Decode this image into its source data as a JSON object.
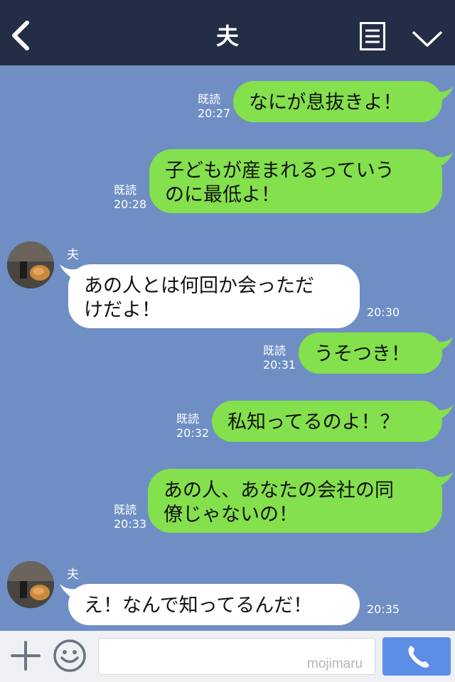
{
  "header": {
    "title": "夫"
  },
  "messages": [
    {
      "type": "sent",
      "read": "既読",
      "time": "20:27",
      "text": "なにが息抜きよ！"
    },
    {
      "type": "sent",
      "read": "既読",
      "time": "20:28",
      "text": "子どもが産まれるっていう\nのに最低よ！"
    },
    {
      "type": "received",
      "sender": "夫",
      "time": "20:30",
      "text": "あの人とは何回か会っただ\nけだよ！"
    },
    {
      "type": "sent",
      "read": "既読",
      "time": "20:31",
      "text": "うそつき！"
    },
    {
      "type": "sent",
      "read": "既読",
      "time": "20:32",
      "text": "私知ってるのよ！？"
    },
    {
      "type": "sent",
      "read": "既読",
      "time": "20:33",
      "text": "あの人、あなたの会社の同\n僚じゃないの！"
    },
    {
      "type": "received",
      "sender": "夫",
      "time": "20:35",
      "text": "え！なんで知ってるんだ！"
    }
  ],
  "footer": {
    "input_value": "",
    "watermark": "mojimaru"
  },
  "colors": {
    "header_bg": "#232d45",
    "chat_bg": "#6f8fc4",
    "sent_bubble": "#84e04c",
    "received_bubble": "#ffffff",
    "call_button": "#5c8ee6"
  }
}
